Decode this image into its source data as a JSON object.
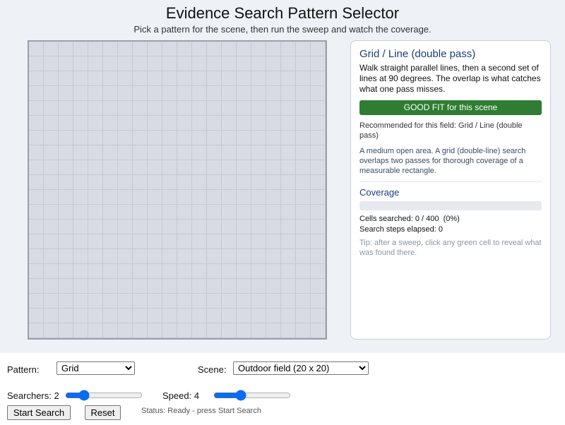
{
  "header": {
    "title": "Evidence Search Pattern Selector",
    "subtitle": "Pick a pattern for the scene, then run the sweep and watch the coverage."
  },
  "grid": {
    "rows": 20,
    "cols": 20,
    "cell_color": "#d8dbe3",
    "line_color": "#c5c9d3"
  },
  "panel": {
    "pattern_name": "Grid / Line (double pass)",
    "pattern_description": "Walk straight parallel lines, then a second set of lines at 90 degrees. The overlap is what catches what one pass misses.",
    "fit_badge": "GOOD FIT for this scene",
    "fit_color": "#2e7d32",
    "recommendation": "Recommended for this field: Grid / Line (double pass)",
    "scene_description": "A medium open area. A grid (double-line) search overlaps two passes for thorough coverage of a measurable rectangle.",
    "coverage_title": "Coverage",
    "coverage_fraction": 0,
    "cells_searched": "Cells searched: 0 / 400  (0%)",
    "steps_elapsed": "Search steps elapsed: 0",
    "tip": "Tip: after a sweep, click any green cell to reveal what was found there."
  },
  "controls": {
    "pattern_label": "Pattern:",
    "pattern_value": "Grid",
    "scene_label": "Scene:",
    "scene_value": "Outdoor field (20 x 20)",
    "searchers_label": "Searchers: 2",
    "searchers_value": 2,
    "speed_label": "Speed: 4",
    "speed_value": 4,
    "start_button": "Start Search",
    "reset_button": "Reset",
    "status": "Status: Ready - press Start Search",
    "accent_color": "#0a6cf0"
  }
}
